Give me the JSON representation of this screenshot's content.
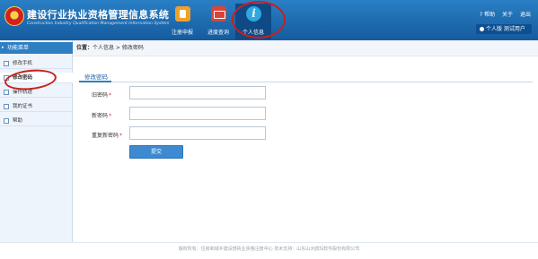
{
  "header": {
    "title": "建设行业执业资格管理信息系统",
    "subtitle": "Construction Industry Qualification Management Information System",
    "nav": [
      {
        "label": "注册申报",
        "icon": "register-icon"
      },
      {
        "label": "进度查询",
        "icon": "progress-icon"
      },
      {
        "label": "个人信息",
        "icon": "info-icon"
      }
    ],
    "help": "帮助",
    "about": "关于",
    "logout": "退出",
    "user": "个人版 测试用户"
  },
  "sidebar": {
    "title": "功能菜单",
    "items": [
      {
        "label": "修改手机"
      },
      {
        "label": "修改密码"
      },
      {
        "label": "操作轨迹"
      },
      {
        "label": "我的证书"
      },
      {
        "label": "帮助"
      }
    ]
  },
  "breadcrumb": {
    "label": "位置：",
    "path": "个人信息 > 修改密码"
  },
  "form": {
    "tab": "修改密码",
    "fields": [
      {
        "label": "旧密码",
        "required": "*",
        "value": ""
      },
      {
        "label": "新密码",
        "required": "*",
        "value": ""
      },
      {
        "label": "重复新密码",
        "required": "*",
        "value": ""
      }
    ],
    "submit": "提交"
  },
  "footer": "版权所有：住房和城乡建设部执业资格注册中心    技术支持：山东山大鸥玛软件股份有限公司",
  "colors": {
    "header_blue": "#1f6db3",
    "accent": "#2e7ec2",
    "annotation_red": "#c91f1f"
  }
}
